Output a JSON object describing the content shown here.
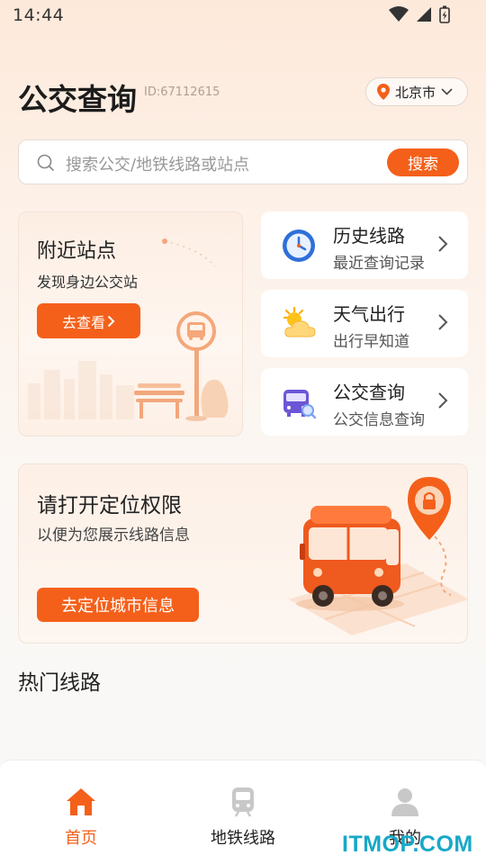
{
  "status_bar": {
    "time": "14:44"
  },
  "header": {
    "title": "公交查询",
    "id_text": "ID:67112615",
    "city": "北京市"
  },
  "search": {
    "placeholder": "搜索公交/地铁线路或站点",
    "button": "搜索"
  },
  "nearby": {
    "title": "附近站点",
    "subtitle": "发现身边公交站",
    "button": "去查看"
  },
  "menu": [
    {
      "title": "历史线路",
      "subtitle": "最近查询记录",
      "icon": "clock-icon"
    },
    {
      "title": "天气出行",
      "subtitle": "出行早知道",
      "icon": "weather-icon"
    },
    {
      "title": "公交查询",
      "subtitle": "公交信息查询",
      "icon": "bus-search-icon"
    }
  ],
  "location": {
    "title": "请打开定位权限",
    "subtitle": "以便为您展示线路信息",
    "button": "去定位城市信息"
  },
  "hot_routes": {
    "title": "热门线路"
  },
  "bottom_nav": [
    {
      "label": "首页",
      "icon": "home-icon",
      "active": true
    },
    {
      "label": "地铁线路",
      "icon": "subway-icon",
      "active": false
    },
    {
      "label": "我的",
      "icon": "user-icon",
      "active": false
    }
  ],
  "watermark": "ITMOP.COM",
  "colors": {
    "accent": "#f4601a",
    "background": "#fdf1e8"
  }
}
